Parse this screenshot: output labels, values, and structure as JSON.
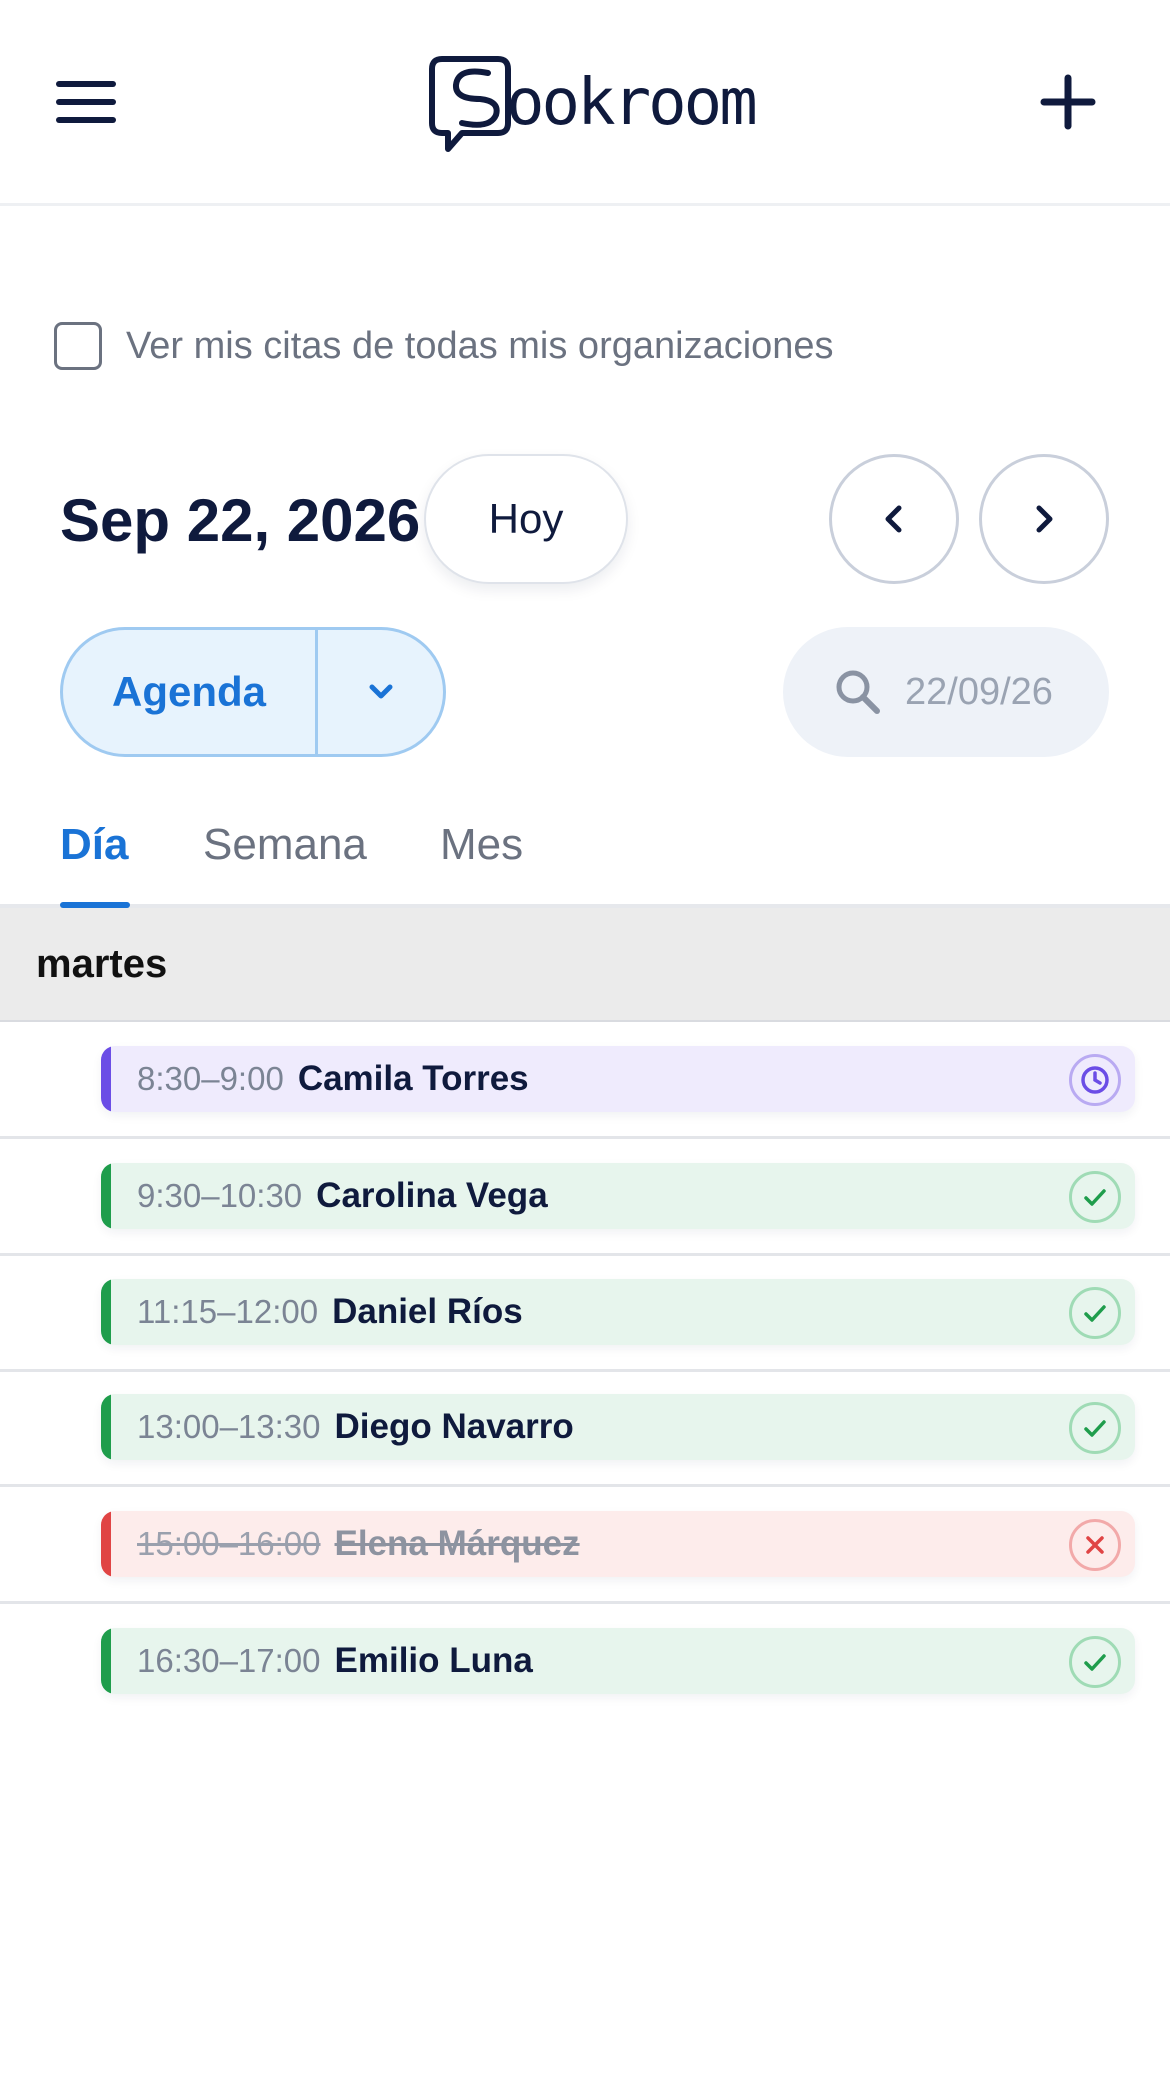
{
  "header": {
    "logo_text": "ookroom",
    "menu_icon": "hamburger-icon",
    "add_icon": "plus-icon"
  },
  "filters": {
    "all_orgs_label": "Ver mis citas de todas mis organizaciones",
    "all_orgs_checked": false
  },
  "date_nav": {
    "current_date": "Sep 22, 2026",
    "today_label": "Hoy",
    "prev_icon": "chevron-left-icon",
    "next_icon": "chevron-right-icon"
  },
  "view_selector": {
    "selected": "Agenda",
    "dropdown_icon": "chevron-down-icon"
  },
  "search": {
    "placeholder": "22/09/26",
    "icon": "search-icon"
  },
  "tabs": [
    {
      "label": "Día",
      "active": true
    },
    {
      "label": "Semana",
      "active": false
    },
    {
      "label": "Mes",
      "active": false
    }
  ],
  "day": {
    "weekday": "martes"
  },
  "appointments": [
    {
      "time": "8:30–9:00",
      "name": "Camila Torres",
      "status": "pending",
      "status_icon": "clock-icon",
      "color": "#6b4de6",
      "bg": "#efebfd"
    },
    {
      "time": "9:30–10:30",
      "name": "Carolina Vega",
      "status": "confirmed",
      "status_icon": "check-icon",
      "color": "#1f9d4c",
      "bg": "#e7f5ed"
    },
    {
      "time": "11:15–12:00",
      "name": "Daniel Ríos",
      "status": "confirmed",
      "status_icon": "check-icon",
      "color": "#1f9d4c",
      "bg": "#e7f5ed"
    },
    {
      "time": "13:00–13:30",
      "name": "Diego Navarro",
      "status": "confirmed",
      "status_icon": "check-icon",
      "color": "#1f9d4c",
      "bg": "#e7f5ed"
    },
    {
      "time": "15:00–16:00",
      "name": "Elena Márquez",
      "status": "cancelled",
      "status_icon": "x-icon",
      "color": "#e04444",
      "bg": "#fdeceb"
    },
    {
      "time": "16:30–17:00",
      "name": "Emilio Luna",
      "status": "confirmed",
      "status_icon": "check-icon",
      "color": "#1f9d4c",
      "bg": "#e7f5ed"
    }
  ],
  "colors": {
    "primary": "#1a73d6",
    "text": "#0f1a3d"
  }
}
